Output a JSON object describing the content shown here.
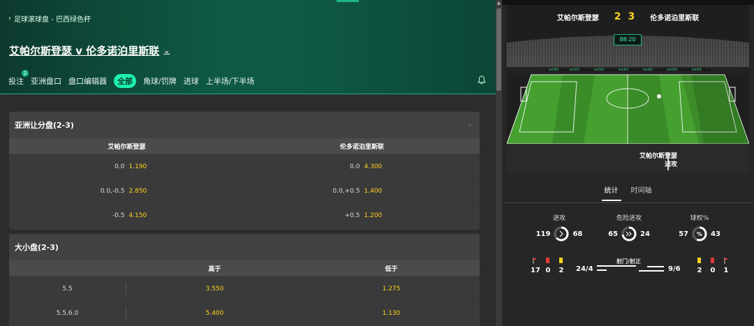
{
  "breadcrumb": {
    "back_icon": "chevron-left-icon",
    "label": "足球滚球盘 - 巴西绿色杯"
  },
  "match": {
    "title": "艾帕尔斯登瑟 v 伦多诺泊里斯联"
  },
  "tabs": [
    {
      "label": "投注",
      "badge": "2"
    },
    {
      "label": "亚洲盘口"
    },
    {
      "label": "盘口编辑器"
    },
    {
      "label": "全部",
      "active": true
    },
    {
      "label": "角球/罚牌"
    },
    {
      "label": "进球"
    },
    {
      "label": "上半场/下半场"
    }
  ],
  "asian_handicap": {
    "title": "亚洲让分盘(2-3)",
    "home": "艾帕尔斯登瑟",
    "away": "伦多诺泊里斯联",
    "rows": [
      {
        "home_line": "0.0",
        "home_odds": "1.190",
        "away_line": "0.0",
        "away_odds": "4.300"
      },
      {
        "home_line": "0.0,-0.5",
        "home_odds": "2.850",
        "away_line": "0.0,+0.5",
        "away_odds": "1.400"
      },
      {
        "home_line": "-0.5",
        "home_odds": "4.150",
        "away_line": "+0.5",
        "away_odds": "1.200"
      }
    ]
  },
  "over_under": {
    "title": "大小盘(2-3)",
    "over_label": "高于",
    "under_label": "低于",
    "rows": [
      {
        "line": "5.5",
        "over": "3.550",
        "under": "1.275"
      },
      {
        "line": "5.5,6.0",
        "over": "5.400",
        "under": "1.130"
      }
    ]
  },
  "scoreboard": {
    "home": "艾帕尔斯登瑟",
    "away": "伦多诺泊里斯联",
    "home_score": "2",
    "away_score": "3",
    "clock": "88:20",
    "event_team": "艾帕尔斯登瑟",
    "event_type": "进攻"
  },
  "stat_tabs": [
    {
      "label": "统计",
      "active": true
    },
    {
      "label": "时间轴"
    }
  ],
  "gauges": [
    {
      "label": "进攻",
      "home": "119",
      "away": "68",
      "home_fraction": 0.636
    },
    {
      "label": "危险进攻",
      "home": "65",
      "away": "24",
      "home_fraction": 0.73
    },
    {
      "label": "球权%",
      "home": "57",
      "away": "43",
      "home_fraction": 0.57
    }
  ],
  "bottom_stats": {
    "home_corners": "17",
    "home_red": "0",
    "home_yellow": "2",
    "ontarget_label": "射门/射正",
    "home_shots": "24/4",
    "away_shots": "9/6",
    "away_yellow": "2",
    "away_red": "0",
    "away_corners": "1"
  },
  "colors": {
    "accent": "#1db386",
    "odds": "#ffd21e",
    "header_bg": "#0e5a44",
    "red_card": "#e23b3b",
    "yellow_card": "#ffd21e"
  }
}
